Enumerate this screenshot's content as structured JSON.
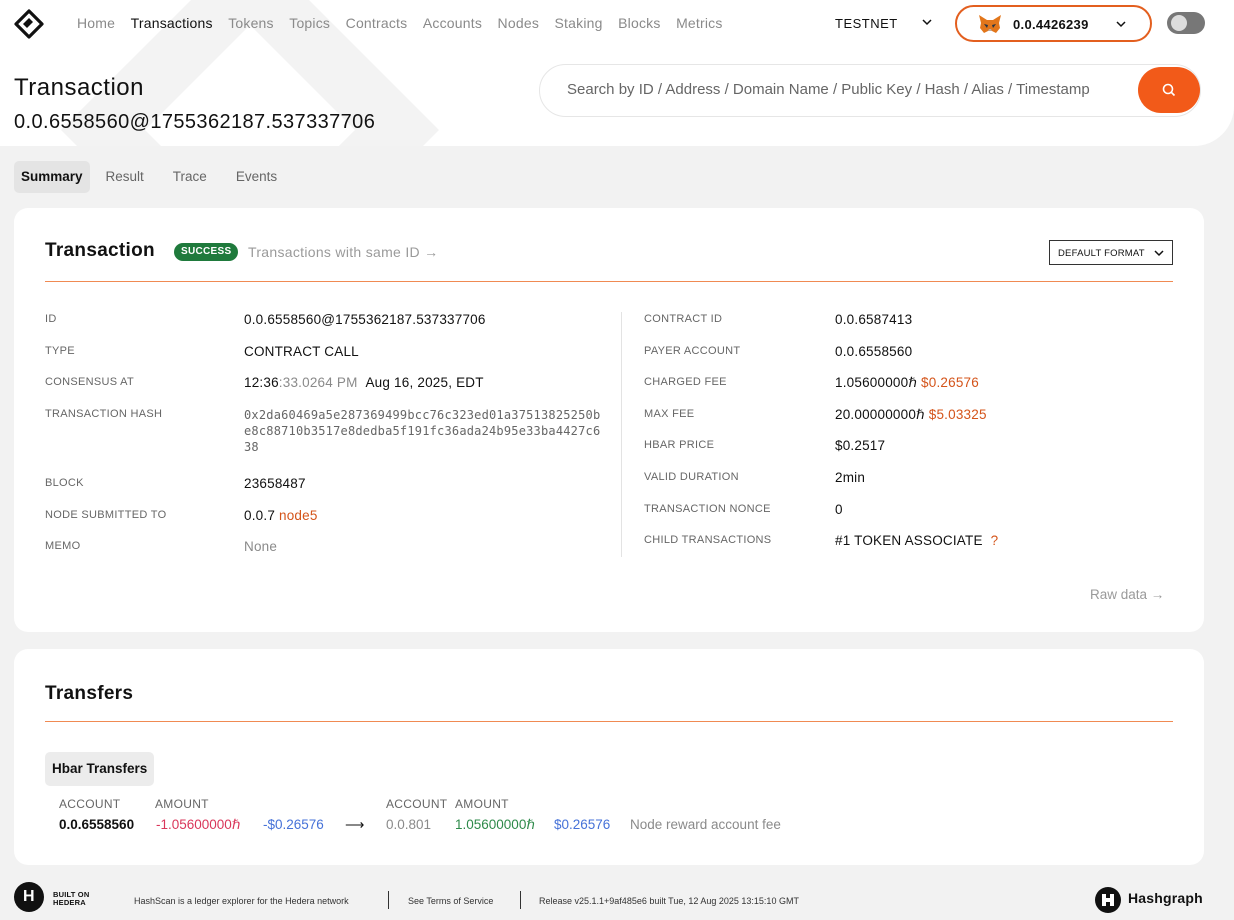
{
  "nav": {
    "items": [
      "Home",
      "Transactions",
      "Tokens",
      "Topics",
      "Contracts",
      "Accounts",
      "Nodes",
      "Staking",
      "Blocks",
      "Metrics"
    ],
    "active": "Transactions",
    "network": "TESTNET",
    "wallet_account": "0.0.4426239"
  },
  "header": {
    "title": "Transaction",
    "subtitle": "0.0.6558560@1755362187.537337706"
  },
  "search": {
    "placeholder": "Search by ID / Address / Domain Name / Public Key / Hash / Alias / Timestamp"
  },
  "tabs": [
    "Summary",
    "Result",
    "Trace",
    "Events"
  ],
  "transaction": {
    "title": "Transaction",
    "status": "SUCCESS",
    "same_id_link": "Transactions with same ID →",
    "format": "DEFAULT FORMAT",
    "left": {
      "id_label": "ID",
      "id": "0.0.6558560@1755362187.537337706",
      "type_label": "TYPE",
      "type": "CONTRACT CALL",
      "consensus_label": "CONSENSUS AT",
      "consensus_hm": "12:36",
      "consensus_rest": ":33.0264 PM",
      "consensus_date": "Aug 16, 2025, EDT",
      "hash_label": "TRANSACTION HASH",
      "hash": "0x2da60469a5e287369499bcc76c323ed01a37513825250be8c88710b3517e8dedba5f191fc36ada24b95e33ba4427c638",
      "block_label": "BLOCK",
      "block": "23658487",
      "node_label": "NODE SUBMITTED TO",
      "node": "0.0.7",
      "node_name": "node5",
      "memo_label": "MEMO",
      "memo": "None"
    },
    "right": {
      "contract_label": "CONTRACT ID",
      "contract": "0.0.6587413",
      "payer_label": "PAYER ACCOUNT",
      "payer": "0.0.6558560",
      "charged_label": "CHARGED FEE",
      "charged": "1.05600000ℏ",
      "charged_usd": "$0.26576",
      "max_label": "MAX FEE",
      "max": "20.00000000ℏ",
      "max_usd": "$5.03325",
      "price_label": "HBAR PRICE",
      "price": "$0.2517",
      "duration_label": "VALID DURATION",
      "duration": "2min",
      "nonce_label": "TRANSACTION NONCE",
      "nonce": "0",
      "child_label": "CHILD TRANSACTIONS",
      "child": "#1  TOKEN ASSOCIATE",
      "child_help": "?"
    },
    "raw_data": "Raw data →"
  },
  "transfers": {
    "title": "Transfers",
    "tab": "Hbar Transfers",
    "col_account": "ACCOUNT",
    "col_amount": "AMOUNT",
    "from": {
      "account": "0.0.6558560",
      "amount": "-1.05600000ℏ",
      "usd": "-$0.26576"
    },
    "arrow": "⟶",
    "to": {
      "account": "0.0.801",
      "amount": "1.05600000ℏ",
      "usd": "$0.26576",
      "note": "Node reward account fee"
    }
  },
  "footer": {
    "built_on": "BUILT ON",
    "hedera": "HEDERA",
    "tagline": "HashScan is a ledger explorer for the Hedera network",
    "terms": "See Terms of Service",
    "release": "Release v25.1.1+9af485e6 built Tue, 12 Aug 2025 13:15:10 GMT",
    "brand": "Hashgraph"
  },
  "colors": {
    "accent": "#f25a19",
    "success": "#1f7a3c",
    "link_orange": "#d4541a"
  }
}
